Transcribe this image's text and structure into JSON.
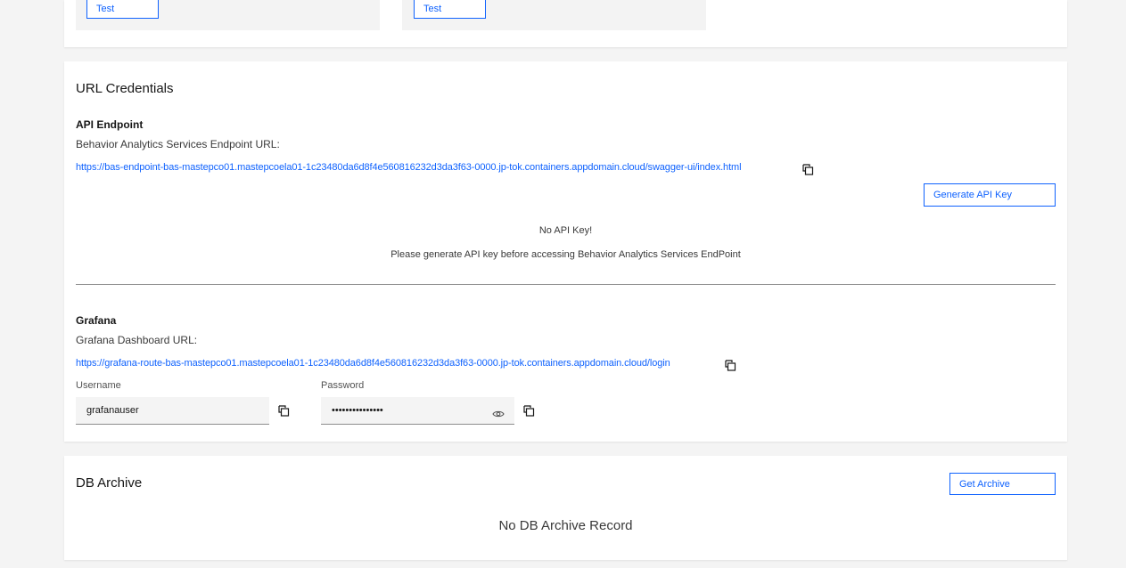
{
  "top_tiles": [
    {
      "button_label": "Test"
    },
    {
      "button_label": "Test"
    }
  ],
  "url_credentials": {
    "title": "URL Credentials",
    "api_endpoint": {
      "heading": "API Endpoint",
      "url_label": "Behavior Analytics Services Endpoint URL:",
      "url": "https://bas-endpoint-bas-mastepco01.mastepcoela01-1c23480da6d8f4e560816232d3da3f63-0000.jp-tok.containers.appdomain.cloud/swagger-ui/index.html",
      "copy_icon": "copy-icon",
      "generate_button": "Generate API Key",
      "no_key_title": "No API Key!",
      "no_key_message": "Please generate API key before accessing Behavior Analytics Services EndPoint"
    },
    "grafana": {
      "heading": "Grafana",
      "url_label": "Grafana Dashboard URL:",
      "url": "https://grafana-route-bas-mastepco01.mastepcoela01-1c23480da6d8f4e560816232d3da3f63-0000.jp-tok.containers.appdomain.cloud/login",
      "username_label": "Username",
      "username_value": "grafanauser",
      "password_label": "Password",
      "password_value": "•••••••••••••••",
      "show_password_icon": "eye-icon"
    }
  },
  "db_archive": {
    "title": "DB Archive",
    "get_button": "Get Archive",
    "empty_message": "No DB Archive Record"
  },
  "colors": {
    "accent": "#0f62fe",
    "background": "#f4f4f4",
    "card": "#ffffff"
  }
}
